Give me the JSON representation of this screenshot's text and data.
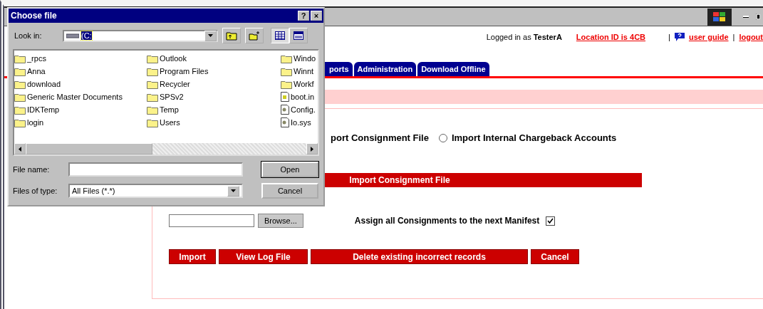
{
  "header": {
    "logged_in_prefix": "Logged in as",
    "user": "TesterA",
    "location_link": "Location ID is 4CB",
    "separator": "|",
    "user_guide_link": "user guide",
    "separator_2": "|",
    "logout_link": "logout"
  },
  "tabs": [
    {
      "label": "ports",
      "selected": false
    },
    {
      "label": "Administration",
      "selected": false
    },
    {
      "label": "Download Offline",
      "selected": false
    }
  ],
  "import_options": [
    {
      "label": "port Consignment File"
    },
    {
      "label": "Import Internal Chargeback Accounts",
      "selected": false
    }
  ],
  "section_title": "Import Consignment File",
  "browse_button": "Browse...",
  "assign_label": "Assign all Consignments to the next Manifest",
  "assign_checked": true,
  "actions": [
    "Import",
    "View Log File",
    "Delete existing incorrect records",
    "Cancel"
  ],
  "dialog": {
    "title": "Choose file",
    "help_button": "?",
    "close_button": "×",
    "look_in_label": "Look in:",
    "look_in_value": "(C:",
    "files": [
      {
        "name": "_rpcs",
        "kind": "folder"
      },
      {
        "name": "Anna",
        "kind": "folder"
      },
      {
        "name": "download",
        "kind": "folder"
      },
      {
        "name": "Generic Master Documents",
        "kind": "folder"
      },
      {
        "name": "IDKTemp",
        "kind": "folder"
      },
      {
        "name": "login",
        "kind": "folder"
      },
      {
        "name": "Outlook",
        "kind": "folder"
      },
      {
        "name": "Program Files",
        "kind": "folder"
      },
      {
        "name": "Recycler",
        "kind": "folder"
      },
      {
        "name": "SPSv2",
        "kind": "folder"
      },
      {
        "name": "Temp",
        "kind": "folder"
      },
      {
        "name": "Users",
        "kind": "folder"
      },
      {
        "name": "Windo",
        "kind": "folder"
      },
      {
        "name": "Winnt",
        "kind": "folder"
      },
      {
        "name": "Workf",
        "kind": "folder"
      },
      {
        "name": "boot.in",
        "kind": "settings"
      },
      {
        "name": "Config.",
        "kind": "system"
      },
      {
        "name": "Io.sys",
        "kind": "system"
      }
    ],
    "file_name_label": "File name:",
    "files_of_type_label": "Files of type:",
    "files_of_type_value": "All Files (*.*)",
    "open_button": "Open",
    "cancel_button": "Cancel"
  }
}
